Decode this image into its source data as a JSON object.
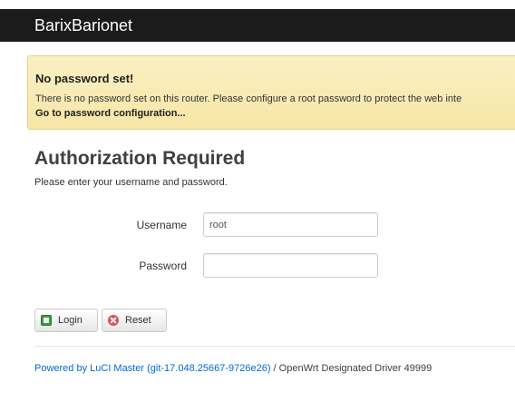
{
  "colors": {
    "navbar_bg": "#1b1b1b",
    "alert_bg": "#fbf0c4",
    "link": "#0069d6"
  },
  "navbar": {
    "brand": "BarixBarionet"
  },
  "alert": {
    "title": "No password set!",
    "text": "There is no password set on this router. Please configure a root password to protect the web inte",
    "link_label": "Go to password configuration..."
  },
  "auth": {
    "title": "Authorization Required",
    "description": "Please enter your username and password.",
    "username_label": "Username",
    "username_value": "root",
    "password_label": "Password",
    "password_value": ""
  },
  "buttons": {
    "login_label": "Login",
    "login_icon": "apply-icon",
    "reset_label": "Reset",
    "reset_icon": "reset-icon"
  },
  "footer": {
    "powered_link": "Powered by LuCI Master (git-17.048.25667-9726e26)",
    "separator": " / ",
    "distribution": "OpenWrt Designated Driver 49999"
  }
}
